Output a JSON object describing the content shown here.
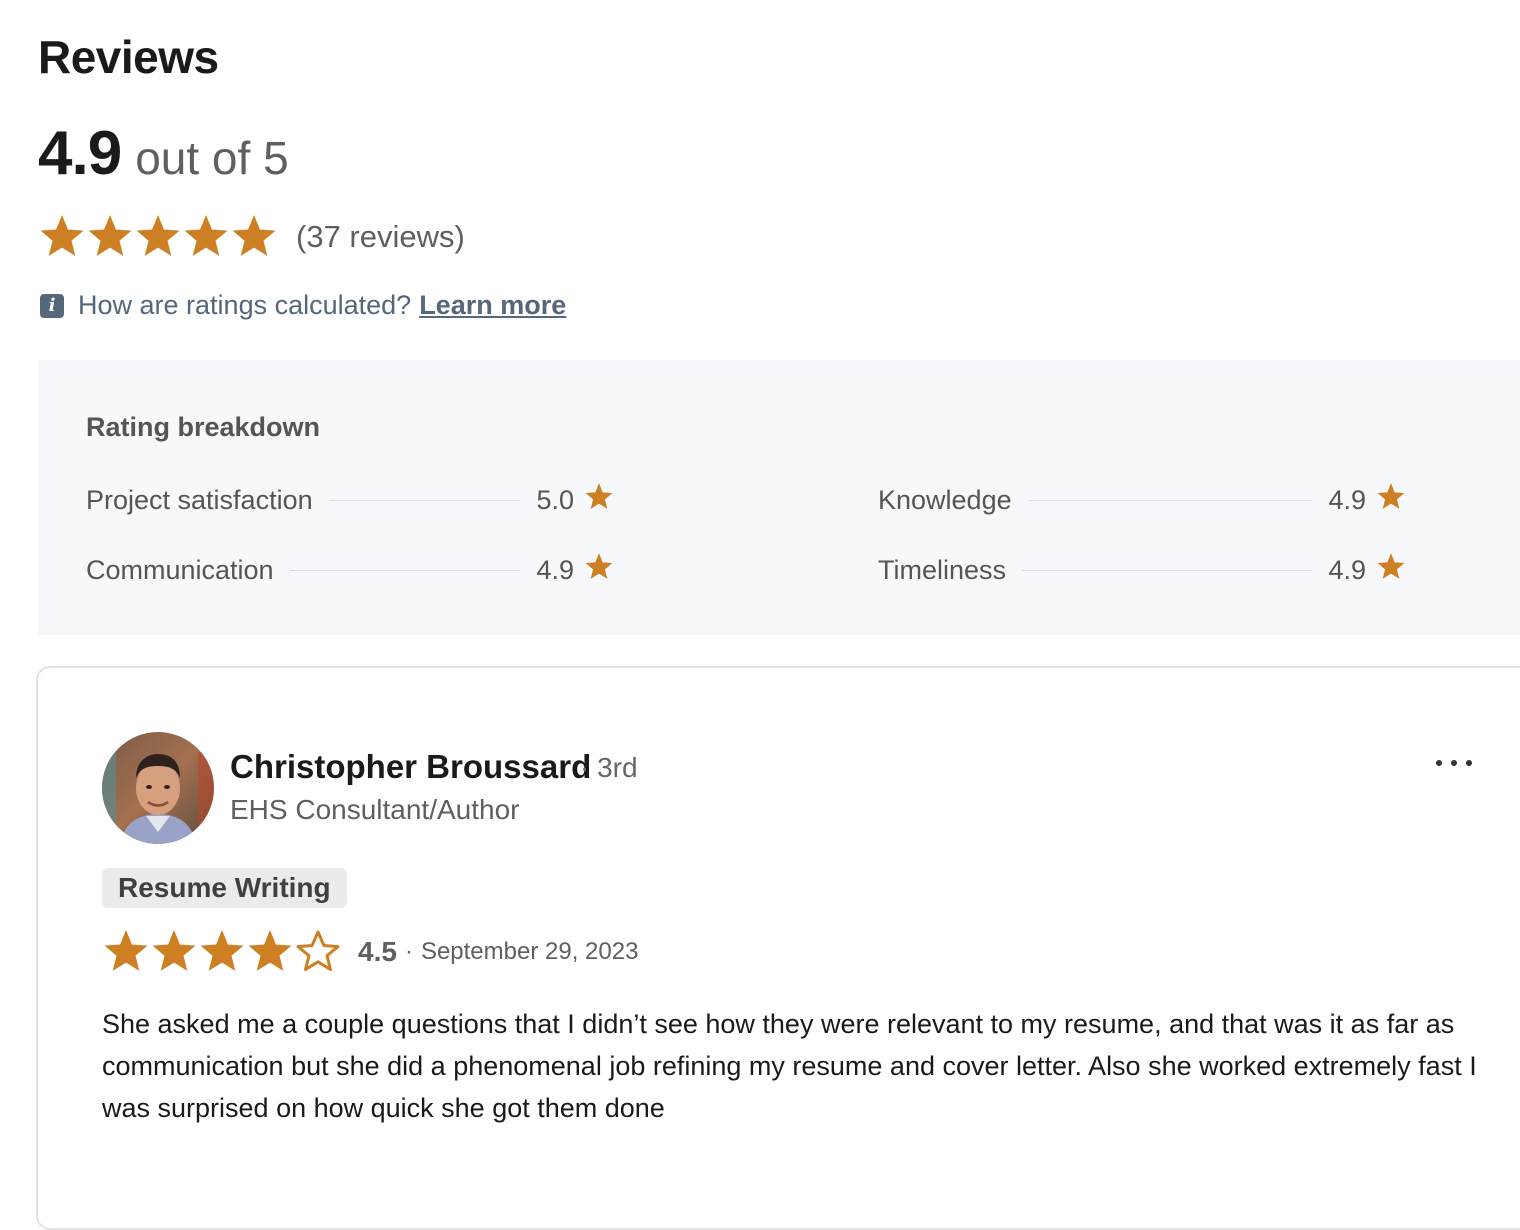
{
  "page": {
    "title": "Reviews"
  },
  "summary": {
    "score": "4.9",
    "out_of": "out of 5",
    "rating_value": 4.9,
    "rating_max": 5,
    "review_count": "(37 reviews)",
    "star_color": "#cc7f23"
  },
  "info": {
    "icon": "info-icon",
    "question": "How are ratings calculated?",
    "link": "Learn more"
  },
  "breakdown": {
    "title": "Rating breakdown",
    "items": [
      {
        "label": "Project satisfaction",
        "value": "5.0"
      },
      {
        "label": "Knowledge",
        "value": "4.9"
      },
      {
        "label": "Communication",
        "value": "4.9"
      },
      {
        "label": "Timeliness",
        "value": "4.9"
      }
    ]
  },
  "review": {
    "name": "Christopher Broussard",
    "degree": "· 3rd",
    "headline": "EHS Consultant/Author",
    "more_icon": "more-options-icon",
    "tag": "Resume Writing",
    "rating_value": 4.5,
    "score": "4.5",
    "separator": "·",
    "date": "September 29, 2023",
    "text": "She asked me a couple questions that I didn’t see how they were relevant to my resume, and that was it as far as communication but she did a phenomenal job refining my resume and cover letter. Also she worked extremely fast I was surprised on how quick she got them done"
  }
}
